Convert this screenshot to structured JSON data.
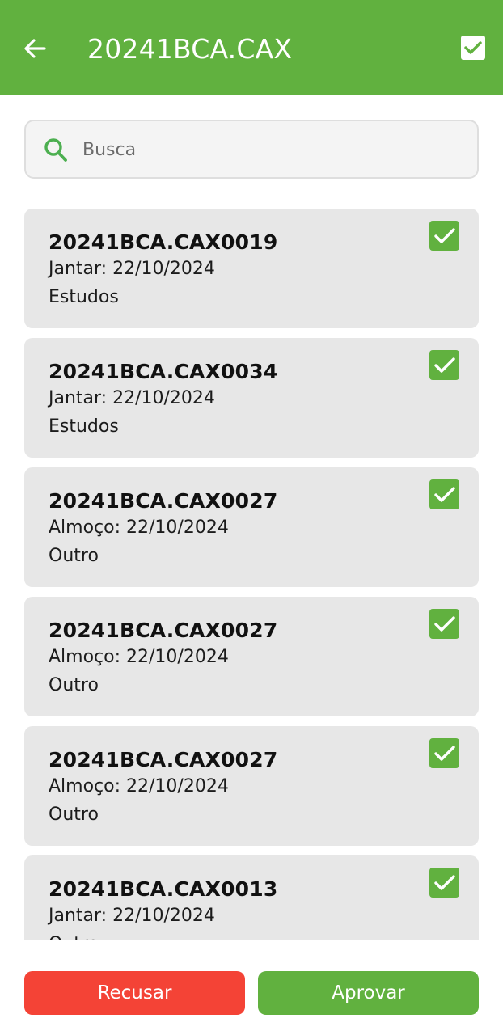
{
  "header": {
    "title": "20241BCA.CAX",
    "back_icon": "arrow-left-icon",
    "select_all_icon": "checkbox-checked-icon",
    "background_color": "#61b13f"
  },
  "search": {
    "placeholder": "Busca",
    "value": "",
    "icon": "search-icon"
  },
  "items": [
    {
      "code": "20241BCA.CAX0019",
      "meal": "Jantar: 22/10/2024",
      "reason": "Estudos",
      "checked": true
    },
    {
      "code": "20241BCA.CAX0034",
      "meal": "Jantar: 22/10/2024",
      "reason": "Estudos",
      "checked": true
    },
    {
      "code": "20241BCA.CAX0027",
      "meal": "Almoço: 22/10/2024",
      "reason": "Outro",
      "checked": true
    },
    {
      "code": "20241BCA.CAX0027",
      "meal": "Almoço: 22/10/2024",
      "reason": "Outro",
      "checked": true
    },
    {
      "code": "20241BCA.CAX0027",
      "meal": "Almoço: 22/10/2024",
      "reason": "Outro",
      "checked": true
    },
    {
      "code": "20241BCA.CAX0013",
      "meal": "Jantar: 22/10/2024",
      "reason": "Outro",
      "checked": true
    }
  ],
  "actions": {
    "reject_label": "Recusar",
    "approve_label": "Aprovar",
    "reject_color": "#f44336",
    "approve_color": "#61b13f"
  }
}
